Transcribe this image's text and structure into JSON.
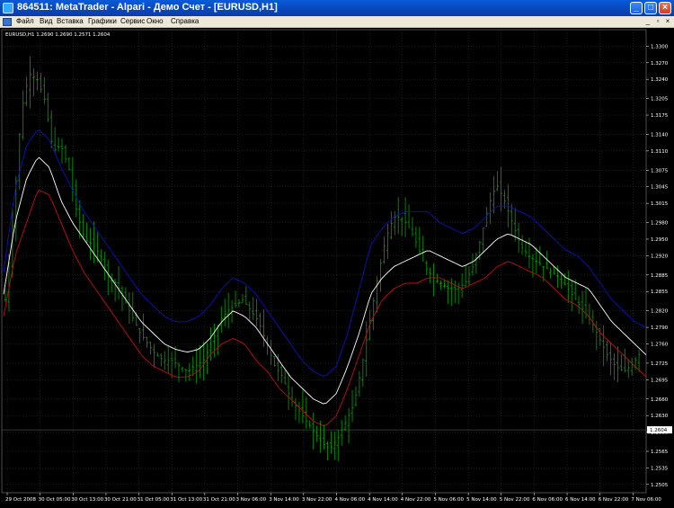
{
  "window": {
    "title": "864511: MetaTrader - Alpari - Демо Счет - [EURUSD,H1]",
    "controls": [
      "_",
      "□",
      "×"
    ]
  },
  "menu": {
    "items": [
      "Файл",
      "Вид",
      "Вставка",
      "Графики",
      "Сервис",
      "Окно",
      "Справка"
    ],
    "right_controls": [
      "_",
      "▫",
      "×"
    ]
  },
  "chart_header": "EURUSD,H1  1.2690 1.2690 1.2571 1.2604",
  "colors": {
    "background": "#000000",
    "bar": "#00a000",
    "grid": "#3a3a3a",
    "ma_white": "#ffffff",
    "ma_red": "#c01010",
    "ma_blue": "#1010b8",
    "current_price_box": "#ffffff"
  },
  "chart_data": {
    "type": "line",
    "symbol": "EURUSD",
    "timeframe": "H1",
    "ohlc_header": {
      "open": 1.269,
      "high": 1.269,
      "low": 1.2571,
      "close": 1.2604
    },
    "current_price": "1.2604",
    "y_ticks": [
      "1.3300",
      "1.3270",
      "1.3240",
      "1.3205",
      "1.3175",
      "1.3140",
      "1.3110",
      "1.3075",
      "1.3045",
      "1.3015",
      "1.2980",
      "1.2950",
      "1.2920",
      "1.2885",
      "1.2855",
      "1.2820",
      "1.2790",
      "1.2760",
      "1.2725",
      "1.2695",
      "1.2660",
      "1.2630",
      "1.2600",
      "1.2565",
      "1.2535",
      "1.2505"
    ],
    "x_ticks": [
      "29 Oct 2008",
      "30 Oct 05:00",
      "30 Oct 13:00",
      "30 Oct 21:00",
      "31 Oct 05:00",
      "31 Oct 13:00",
      "31 Oct 21:00",
      "3 Nov 06:00",
      "3 Nov 14:00",
      "3 Nov 22:00",
      "4 Nov 06:00",
      "4 Nov 14:00",
      "4 Nov 22:00",
      "5 Nov 06:00",
      "5 Nov 14:00",
      "5 Nov 22:00",
      "6 Nov 06:00",
      "6 Nov 14:00",
      "6 Nov 22:00",
      "7 Nov 06:00"
    ],
    "ylim": [
      1.249,
      1.333
    ],
    "grid": true,
    "price_series": [
      1.284,
      1.299,
      1.318,
      1.325,
      1.324,
      1.32,
      1.311,
      1.312,
      1.308,
      1.3,
      1.295,
      1.294,
      1.292,
      1.288,
      1.287,
      1.284,
      1.281,
      1.278,
      1.276,
      1.274,
      1.273,
      1.273,
      1.272,
      1.271,
      1.272,
      1.273,
      1.276,
      1.28,
      1.282,
      1.283,
      1.284,
      1.282,
      1.28,
      1.276,
      1.272,
      1.27,
      1.266,
      1.264,
      1.262,
      1.26,
      1.258,
      1.257,
      1.259,
      1.262,
      1.265,
      1.272,
      1.28,
      1.288,
      1.295,
      1.299,
      1.299,
      1.297,
      1.294,
      1.29,
      1.288,
      1.287,
      1.286,
      1.286,
      1.287,
      1.29,
      1.295,
      1.301,
      1.305,
      1.302,
      1.298,
      1.294,
      1.292,
      1.291,
      1.29,
      1.289,
      1.288,
      1.286,
      1.284,
      1.282,
      1.28,
      1.277,
      1.274,
      1.272,
      1.271,
      1.272,
      1.274
    ],
    "series": [
      {
        "values": [
          1.285,
          1.298,
          1.306,
          1.31,
          1.308,
          1.302,
          1.298,
          1.295,
          1.292,
          1.289,
          1.286,
          1.283,
          1.28,
          1.278,
          1.276,
          1.275,
          1.2745,
          1.275,
          1.277,
          1.28,
          1.282,
          1.281,
          1.279,
          1.276,
          1.273,
          1.27,
          1.268,
          1.266,
          1.265,
          1.267,
          1.272,
          1.278,
          1.285,
          1.288,
          1.29,
          1.291,
          1.292,
          1.293,
          1.292,
          1.291,
          1.29,
          1.291,
          1.293,
          1.295,
          1.296,
          1.295,
          1.294,
          1.292,
          1.29,
          1.288,
          1.287,
          1.286,
          1.283,
          1.28,
          1.278,
          1.276,
          1.274
        ]
      },
      {
        "values": [
          1.281,
          1.292,
          1.298,
          1.304,
          1.303,
          1.298,
          1.293,
          1.289,
          1.286,
          1.283,
          1.28,
          1.277,
          1.274,
          1.272,
          1.271,
          1.27,
          1.27,
          1.271,
          1.274,
          1.276,
          1.277,
          1.276,
          1.273,
          1.271,
          1.268,
          1.266,
          1.264,
          1.262,
          1.261,
          1.263,
          1.268,
          1.274,
          1.28,
          1.284,
          1.286,
          1.287,
          1.287,
          1.288,
          1.288,
          1.287,
          1.286,
          1.287,
          1.288,
          1.29,
          1.291,
          1.29,
          1.289,
          1.288,
          1.286,
          1.284,
          1.283,
          1.281,
          1.278,
          1.276,
          1.274,
          1.272,
          1.27
        ]
      },
      {
        "values": [
          1.289,
          1.304,
          1.312,
          1.315,
          1.313,
          1.308,
          1.304,
          1.3,
          1.297,
          1.294,
          1.291,
          1.288,
          1.285,
          1.283,
          1.281,
          1.28,
          1.28,
          1.281,
          1.283,
          1.286,
          1.288,
          1.287,
          1.285,
          1.282,
          1.279,
          1.276,
          1.273,
          1.271,
          1.27,
          1.272,
          1.278,
          1.286,
          1.294,
          1.297,
          1.299,
          1.3,
          1.3,
          1.3,
          1.298,
          1.297,
          1.296,
          1.297,
          1.299,
          1.301,
          1.301,
          1.3,
          1.299,
          1.297,
          1.295,
          1.293,
          1.292,
          1.29,
          1.287,
          1.284,
          1.282,
          1.28,
          1.279
        ]
      }
    ]
  }
}
